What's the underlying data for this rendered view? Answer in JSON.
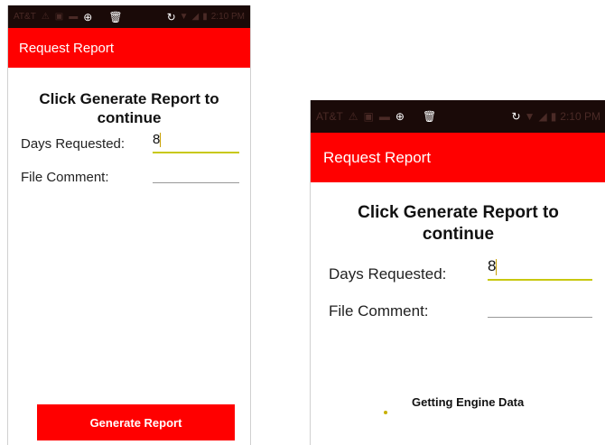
{
  "status_bar": {
    "carrier": "AT&T",
    "time": "2:10 PM"
  },
  "left_screen": {
    "app_title": "Request Report",
    "heading": "Click Generate Report to continue",
    "days_label": "Days Requested:",
    "days_value": "8",
    "comment_label": "File Comment:",
    "comment_value": "",
    "button_label": "Generate Report"
  },
  "right_screen": {
    "app_title": "Request Report",
    "heading": "Click Generate Report to continue",
    "days_label": "Days Requested:",
    "days_value": "8",
    "comment_label": "File Comment:",
    "comment_value": "",
    "progress_text": "Getting Engine Data"
  },
  "colors": {
    "accent": "#ff0000",
    "status_bar": "#1a0a08",
    "field_focus": "#c8c810"
  },
  "icons": [
    "warning-icon",
    "image-icon",
    "message-icon",
    "zoom-icon",
    "trash-icon",
    "sync-icon",
    "wifi-icon",
    "signal-icon",
    "battery-icon"
  ]
}
